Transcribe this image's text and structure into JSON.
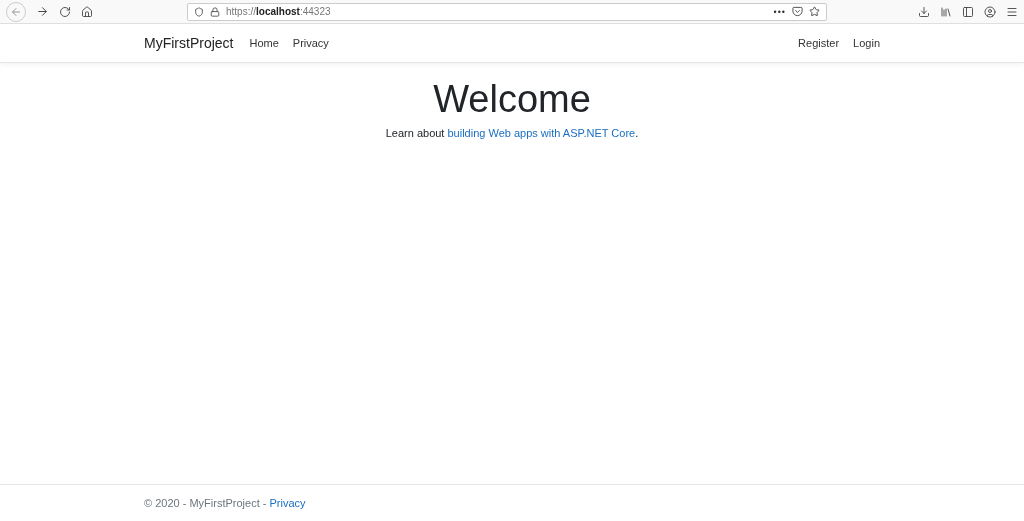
{
  "browser": {
    "url": "https://**localhost**:44323",
    "page_actions": "•••"
  },
  "navbar": {
    "brand": "MyFirstProject",
    "left_links": [
      "Home",
      "Privacy"
    ],
    "right_links": [
      "Register",
      "Login"
    ]
  },
  "main": {
    "heading": "Welcome",
    "lead_before": "Learn about ",
    "lead_link": "building Web apps with ASP.NET Core",
    "lead_after": "."
  },
  "footer": {
    "text": "© 2020 - MyFirstProject - ",
    "link": "Privacy"
  }
}
